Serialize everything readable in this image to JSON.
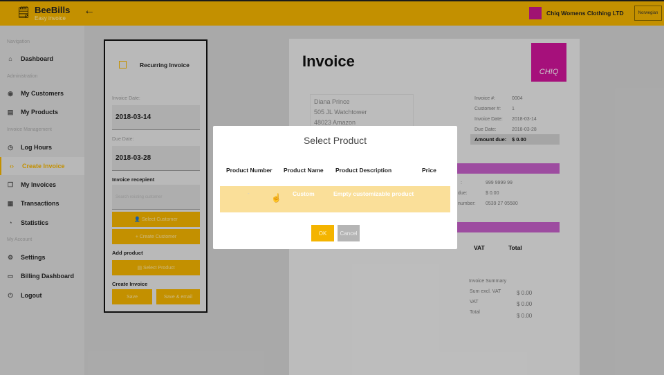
{
  "header": {
    "brand": "BeeBills",
    "tagline": "Easy invoice",
    "company": "Chiq Womens Clothing LTD",
    "language": "Norwegian",
    "accent": "#f4b400"
  },
  "sidebar": {
    "sections": {
      "navigation": "Navigation",
      "administration": "Administration",
      "invoice_management": "Invoice Management",
      "my_account": "My Account"
    },
    "items": [
      {
        "label": "Dashboard",
        "icon": "home-icon"
      },
      {
        "label": "My Customers",
        "icon": "eye-icon"
      },
      {
        "label": "My Products",
        "icon": "database-icon"
      },
      {
        "label": "Log Hours",
        "icon": "stopwatch-icon"
      },
      {
        "label": "Create Invoice",
        "icon": "code-icon",
        "active": true
      },
      {
        "label": "My Invoices",
        "icon": "documents-icon"
      },
      {
        "label": "Transactions",
        "icon": "ledger-icon"
      },
      {
        "label": "Statistics",
        "icon": "clock-icon"
      },
      {
        "label": "Settings",
        "icon": "gear-icon"
      },
      {
        "label": "Billing Dashboard",
        "icon": "credit-card-icon"
      },
      {
        "label": "Logout",
        "icon": "power-icon"
      }
    ]
  },
  "form": {
    "recurring_label": "Recurring Invoice",
    "recurring_checked": false,
    "invoice_date_label": "Invoice Date:",
    "invoice_date": "2018-03-14",
    "due_date_label": "Due Date:",
    "due_date": "2018-03-28",
    "recipient_label": "Invoice recepient",
    "recipient_placeholder": "Search existing customer",
    "select_customer": "Select Customer",
    "create_customer": "Create Customer",
    "add_product_label": "Add product",
    "select_product": "Select Product",
    "create_invoice_label": "Create Invoice",
    "save": "Save",
    "save_email": "Save & email"
  },
  "invoice": {
    "title": "Invoice",
    "logo_text": "CHIQ",
    "address": [
      "Diana Prince",
      "505 JL Watchtower",
      "48023 Amazon"
    ],
    "meta": [
      {
        "label": "Invoice #:",
        "value": "0004"
      },
      {
        "label": "Customer #:",
        "value": "1"
      },
      {
        "label": "Invoice Date:",
        "value": "2018-03-14"
      },
      {
        "label": "Due Date:",
        "value": "2018-03-28"
      }
    ],
    "amount_due_label": "Amount due:",
    "amount_due": "$ 0.00",
    "payment": [
      {
        "label": ":",
        "value": "999 9999 99"
      },
      {
        "label": "due:",
        "value": "$ 0.00"
      },
      {
        "label": "number:",
        "value": "0539 27 05580"
      }
    ],
    "columns": {
      "vat": "VAT",
      "total": "Total"
    },
    "summary": {
      "title": "Invoice Summary",
      "rows": [
        {
          "label": "Sum excl. VAT",
          "value": "$ 0.00"
        },
        {
          "label": "VAT",
          "value": "$ 0.00"
        },
        {
          "label": "Total",
          "value": "$ 0.00"
        }
      ]
    },
    "accent": "#c560c8"
  },
  "modal": {
    "title": "Select Product",
    "headers": [
      "Product Number",
      "Product Name",
      "Product Description",
      "Price"
    ],
    "rows": [
      {
        "number": "-",
        "name": "Custom",
        "description": "Empty customizable product",
        "price": ""
      }
    ],
    "ok": "OK",
    "cancel": "Cancel"
  }
}
